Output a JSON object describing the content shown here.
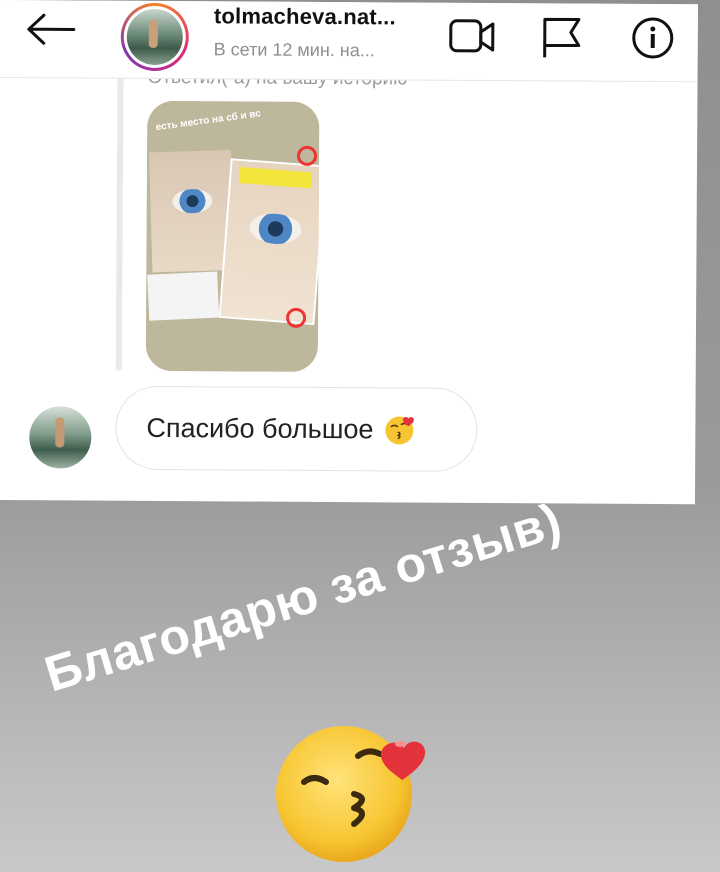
{
  "header": {
    "username": "tolmacheva.nat...",
    "status": "В сети 12 мин. на...",
    "icons": [
      "back-arrow-icon",
      "video-call-icon",
      "flag-icon",
      "info-icon"
    ]
  },
  "conversation": {
    "reply_label": "Ответил(-а) на вашу историю",
    "story_caption": "есть место на сб и вс",
    "message_text": "Спасибо большое"
  },
  "overlay": {
    "caption": "Благодарю за отзыв)"
  },
  "colors": {
    "background": "#9a9a9a",
    "story_ring": "#dd2a7b",
    "emoji_yellow": "#f7c531",
    "heart": "#e3323a"
  }
}
